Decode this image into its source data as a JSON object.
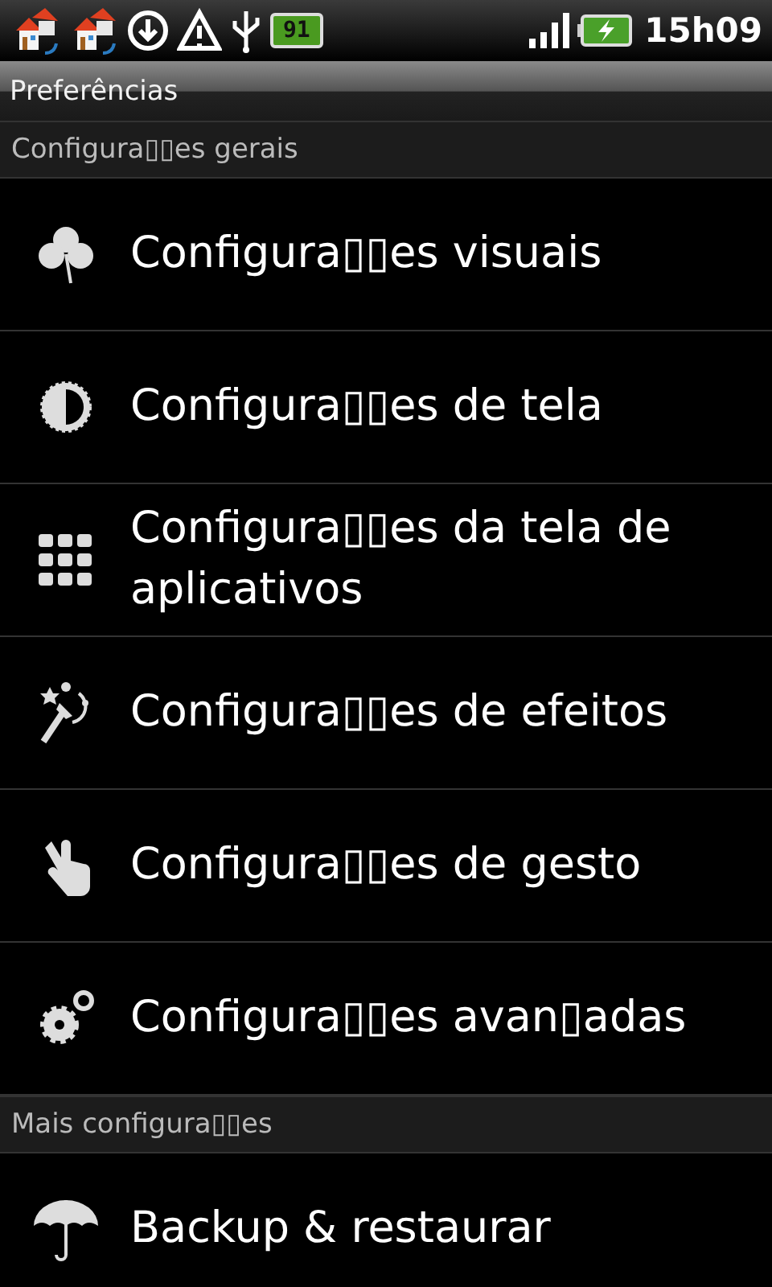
{
  "status_bar": {
    "battery_widget": "91",
    "time": "15h09"
  },
  "title": "Preferências",
  "sections": [
    {
      "header": "Configura▯▯es gerais",
      "items": [
        {
          "label": "Configura▯▯es visuais"
        },
        {
          "label": "Configura▯▯es de tela"
        },
        {
          "label": "Configura▯▯es da tela de aplicativos"
        },
        {
          "label": "Configura▯▯es de efeitos"
        },
        {
          "label": "Configura▯▯es de gesto"
        },
        {
          "label": "Configura▯▯es avan▯adas"
        }
      ]
    },
    {
      "header": "Mais configura▯▯es",
      "items": [
        {
          "label": "Backup & restaurar"
        }
      ]
    }
  ]
}
